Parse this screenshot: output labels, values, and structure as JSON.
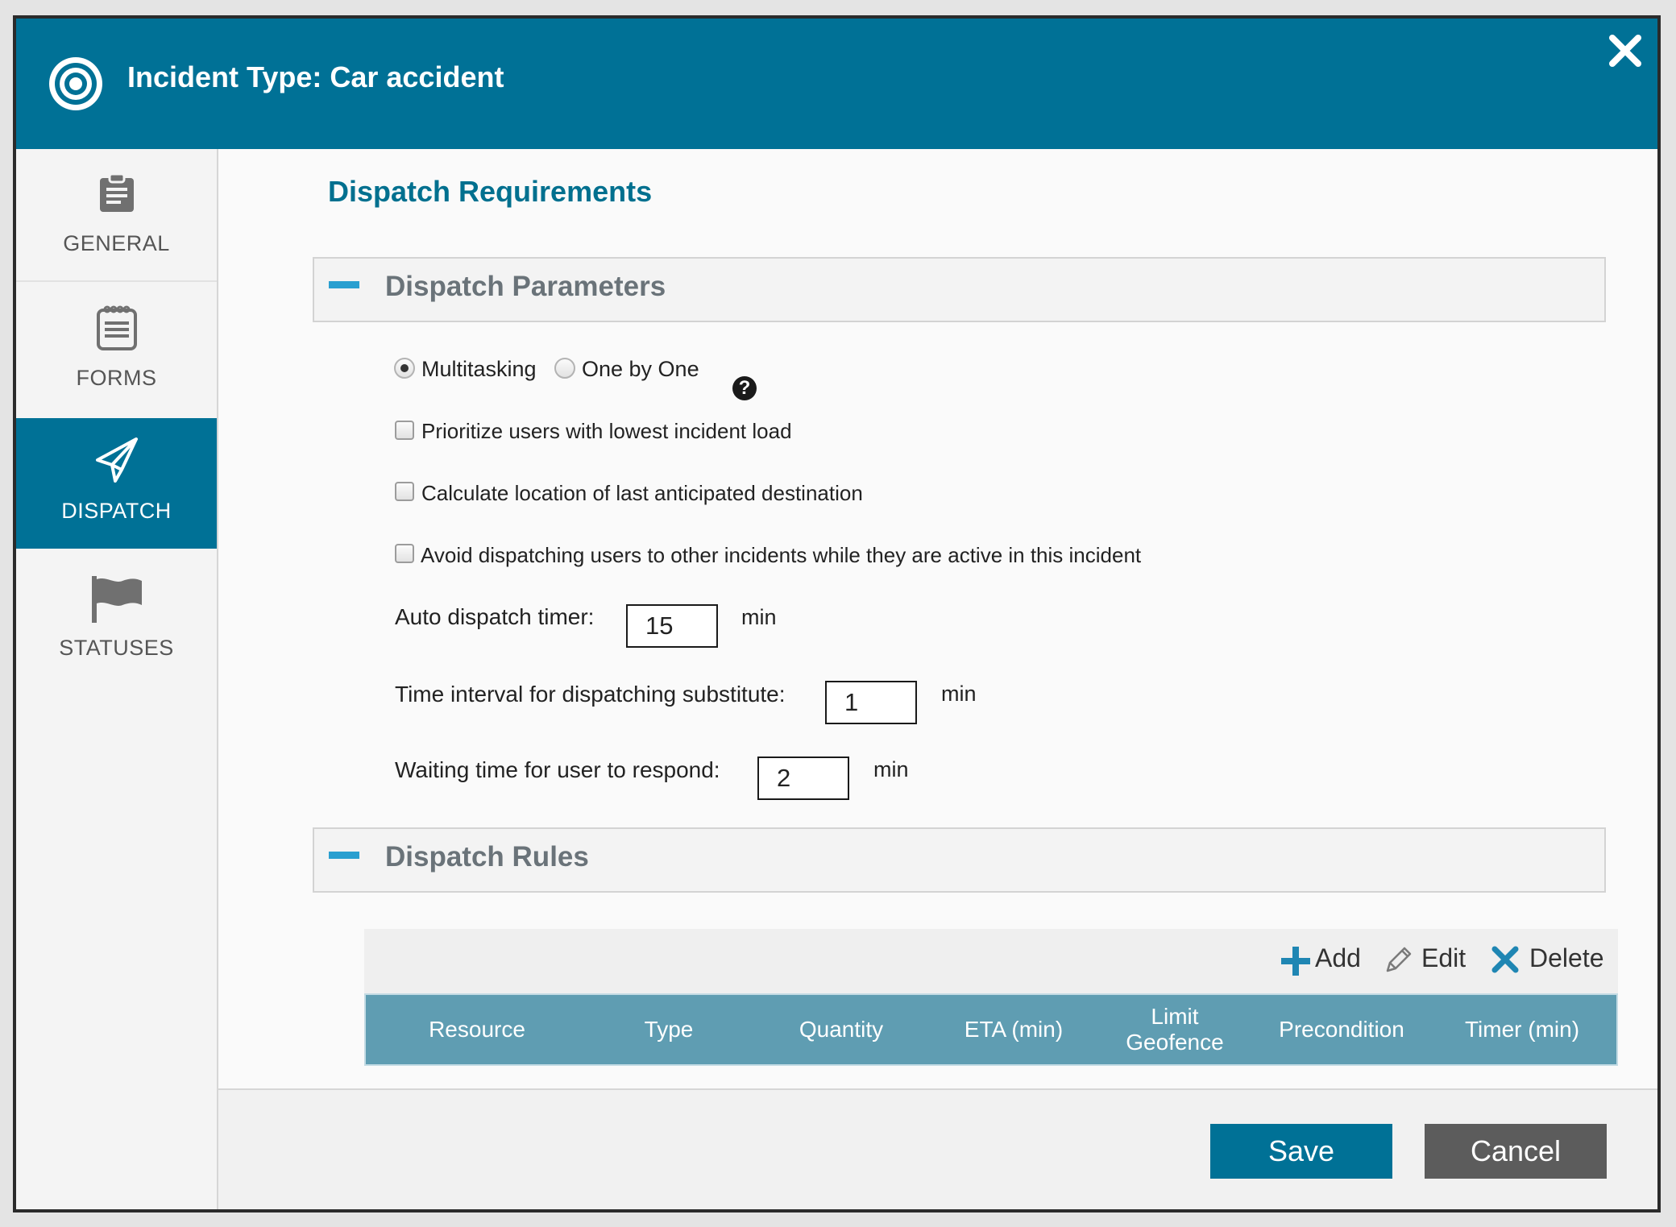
{
  "header": {
    "title": "Incident Type: Car accident",
    "icon": "target-icon",
    "close_icon": "close-icon"
  },
  "sidebar": {
    "items": [
      {
        "label": "GENERAL",
        "icon": "clipboard-icon",
        "active": false
      },
      {
        "label": "FORMS",
        "icon": "notepad-icon",
        "active": false
      },
      {
        "label": "DISPATCH",
        "icon": "paper-plane-icon",
        "active": true
      },
      {
        "label": "STATUSES",
        "icon": "flag-icon",
        "active": false
      }
    ]
  },
  "main": {
    "section_title": "Dispatch Requirements",
    "parameters_panel": {
      "title": "Dispatch Parameters",
      "dispatch_mode": {
        "options": [
          "Multitasking",
          "One by One"
        ],
        "selected": "Multitasking"
      },
      "checkboxes": [
        {
          "label": "Prioritize users with lowest incident load",
          "checked": false
        },
        {
          "label": "Calculate location of last anticipated destination",
          "checked": false
        },
        {
          "label": "Avoid dispatching users to other incidents while they are active in this incident",
          "checked": false
        }
      ],
      "fields": [
        {
          "label": "Auto dispatch timer:",
          "value": "15",
          "unit": "min"
        },
        {
          "label": "Time interval for dispatching substitute:",
          "value": "1",
          "unit": "min"
        },
        {
          "label": "Waiting time for user to respond:",
          "value": "2",
          "unit": "min"
        }
      ]
    },
    "rules_panel": {
      "title": "Dispatch Rules",
      "toolbar": {
        "add": "Add",
        "edit": "Edit",
        "delete": "Delete"
      },
      "columns": [
        "Resource",
        "Type",
        "Quantity",
        "ETA (min)",
        "Limit\nGeofence",
        "Precondition",
        "Timer (min)"
      ]
    }
  },
  "footer": {
    "save": "Save",
    "cancel": "Cancel"
  },
  "colors": {
    "brand": "#007196",
    "table_header": "#5f9db2",
    "cancel": "#5c5c5c",
    "accent": "#2a9fd0"
  }
}
